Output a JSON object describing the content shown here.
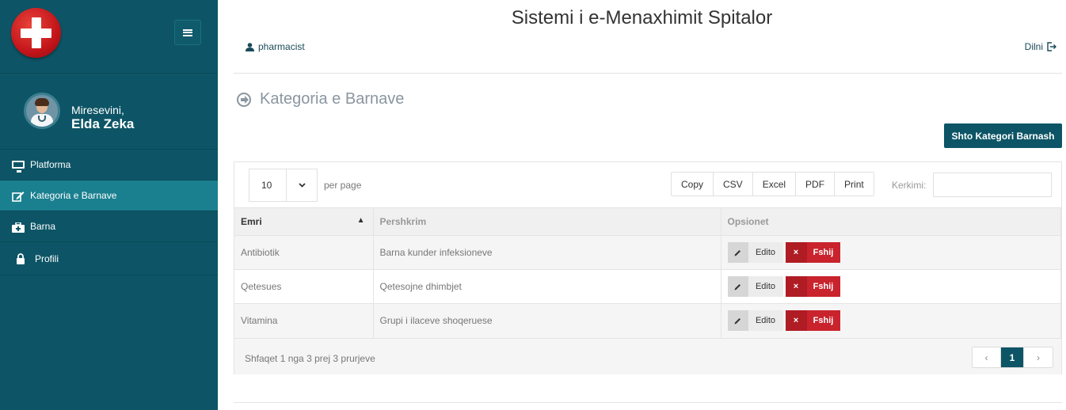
{
  "app": {
    "title": "Sistemi i e-Menaxhimit Spitalor"
  },
  "sidebar": {
    "logo": "red-cross-logo",
    "welcome": "Miresevini,",
    "username": "Elda Zeka",
    "items": [
      {
        "label": "Platforma",
        "icon": "monitor-icon"
      },
      {
        "label": "Kategoria e Barnave",
        "icon": "edit-icon",
        "active": true
      },
      {
        "label": "Barna",
        "icon": "medkit-icon"
      },
      {
        "label": "Profili",
        "icon": "lock-icon"
      }
    ]
  },
  "header": {
    "user": "pharmacist",
    "logout": "Dilni"
  },
  "page": {
    "title": "Kategoria e Barnave",
    "add_button": "Shto Kategori Barnash"
  },
  "table": {
    "page_length": "10",
    "per_page": "per page",
    "exports": [
      "Copy",
      "CSV",
      "Excel",
      "PDF",
      "Print"
    ],
    "search_label": "Kerkimi:",
    "columns": [
      "Emri",
      "Pershkrim",
      "Opsionet"
    ],
    "rows": [
      {
        "name": "Antibiotik",
        "description": "Barna kunder infeksioneve"
      },
      {
        "name": "Qetesues",
        "description": "Qetesojne dhimbjet"
      },
      {
        "name": "Vitamina",
        "description": "Grupi i ilaceve shoqeruese"
      }
    ],
    "edit_label": "Edito",
    "delete_label": "Fshij",
    "info": "Shfaqet 1 nga 3 prej 3 prurjeve",
    "pagination": {
      "prev": "‹",
      "current": "1",
      "next": "›"
    }
  },
  "colors": {
    "primary": "#0d5566",
    "active_nav": "#1a7f8f",
    "danger": "#c9232d"
  }
}
